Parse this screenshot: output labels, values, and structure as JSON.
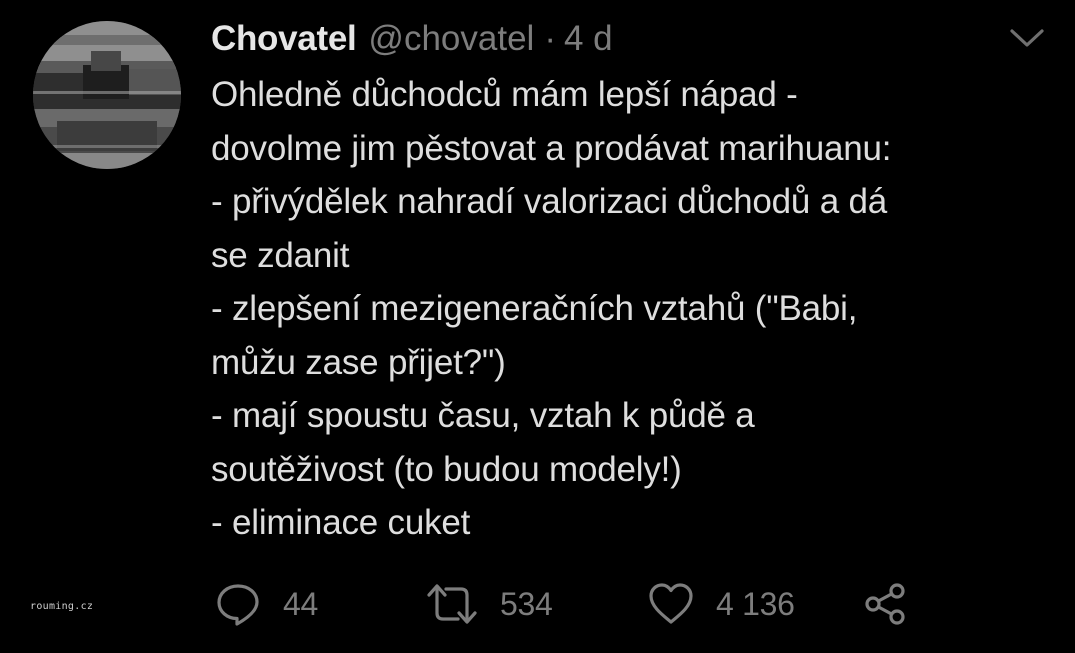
{
  "tweet": {
    "display_name": "Chovatel",
    "handle": "@chovatel",
    "separator": "·",
    "time": "4 d",
    "lines": [
      "Ohledně důchodců mám lepší nápad -",
      "dovolme jim pěstovat a prodávat marihuanu:",
      "- přivýdělek nahradí valorizaci důchodů a dá",
      "se zdanit",
      "- zlepšení mezigeneračních vztahů (\"Babi,",
      "můžu zase přijet?\")",
      "- mají spoustu času, vztah k půdě a",
      "soutěživost (to budou modely!)",
      "- eliminace cuket"
    ]
  },
  "actions": {
    "reply": {
      "icon": "reply-icon",
      "count": "44"
    },
    "retweet": {
      "icon": "retweet-icon",
      "count": "534"
    },
    "like": {
      "icon": "heart-icon",
      "count": "4 136"
    },
    "share": {
      "icon": "share-icon"
    }
  },
  "watermark": "rouming.cz",
  "colors": {
    "background": "#000000",
    "name": "#e6e6e6",
    "text": "#dedede",
    "muted": "#7d7d7d"
  }
}
